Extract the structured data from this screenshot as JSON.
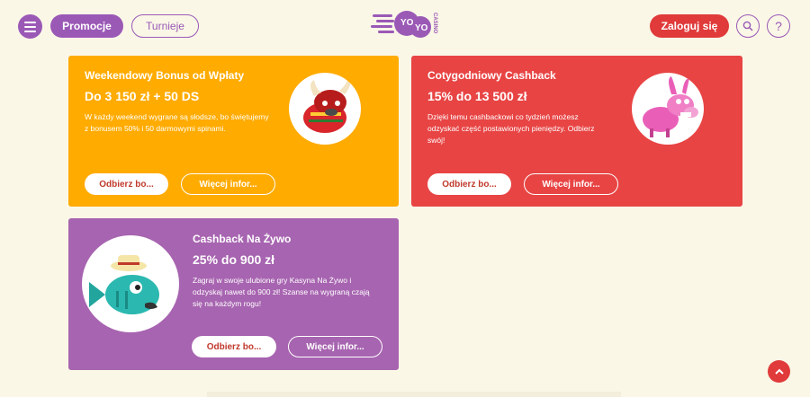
{
  "header": {
    "promo_label": "Promocje",
    "tournaments_label": "Turnieje",
    "login_label": "Zaloguj się",
    "help_glyph": "?",
    "logo_text_top": "YO",
    "logo_text_bottom": "YO",
    "logo_text_side": "CASINO",
    "icons": [
      "menu-icon",
      "search-icon",
      "help-icon"
    ]
  },
  "promotions": [
    {
      "title": "Weekendowy Bonus od Wpłaty",
      "amount": "Do 3 150 zł + 50 DS",
      "desc_lines": [
        "W każdy weekend wygrane są słodsze, bo świętujemy",
        "z bonusem 50% i 50 darmowymi spinami."
      ],
      "claim_label": "Odbierz bo...",
      "more_label": "Więcej infor...",
      "mascot": "bull-pinata-icon",
      "color": "#ffab00"
    },
    {
      "title": "Cotygodniowy Cashback",
      "amount": "15% do 13 500 zł",
      "desc_lines": [
        "Dzięki temu cashbackowi co tydzień możesz",
        "odzyskać część postawionych pieniędzy. Odbierz",
        "swój!"
      ],
      "claim_label": "Odbierz bo...",
      "more_label": "Więcej infor...",
      "mascot": "donkey-pinata-icon",
      "color": "#e84444"
    },
    {
      "title": "Cashback Na Żywo",
      "amount": "25% do 900 zł",
      "desc_lines": [
        "Zagraj w swoje ulubione gry Kasyna Na Żywo i",
        "odzyskaj nawet do 900 zł! Szanse na wygraną czają",
        "się na każdym rogu!"
      ],
      "claim_label": "Odbierz bo...",
      "more_label": "Więcej infor...",
      "mascot": "fish-pinata-icon",
      "color": "#a764b0"
    }
  ],
  "scroll_top_icon": "chevron-up-icon"
}
